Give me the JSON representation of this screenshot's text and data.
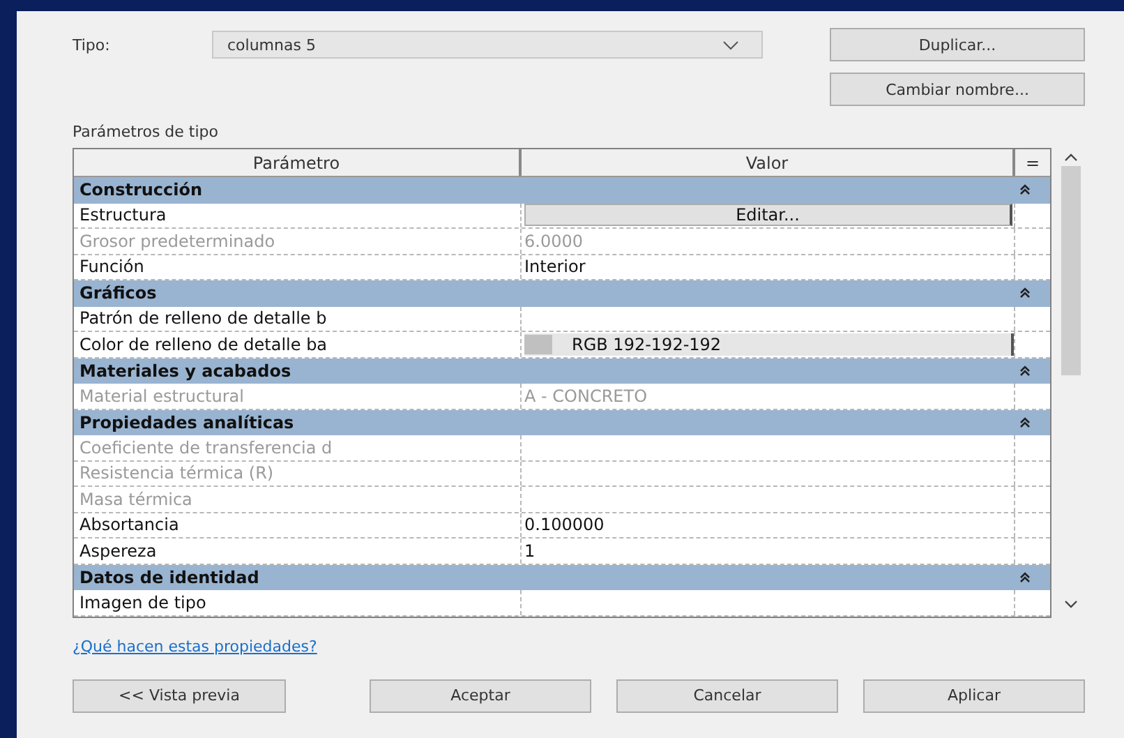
{
  "type_field": {
    "label": "Tipo:",
    "value": "columnas 5"
  },
  "top_buttons": [
    "Duplicar...",
    "Cambiar nombre..."
  ],
  "section_label": "Parámetros de tipo",
  "table": {
    "columns": [
      "Parámetro",
      "Valor",
      "="
    ],
    "rows": [
      {
        "kind": "group",
        "label": "Construcción",
        "expanded": true
      },
      {
        "kind": "param",
        "label": "Estructura",
        "disabled": false,
        "value": {
          "kind": "button",
          "text": "Editar..."
        }
      },
      {
        "kind": "param",
        "label": "Grosor predeterminado",
        "disabled": true,
        "value": {
          "kind": "text",
          "text": "6.0000"
        }
      },
      {
        "kind": "param",
        "label": "Función",
        "disabled": false,
        "value": {
          "kind": "text",
          "text": "Interior"
        }
      },
      {
        "kind": "group",
        "label": "Gráficos",
        "expanded": true
      },
      {
        "kind": "param",
        "label": "Patrón de relleno de detalle b",
        "disabled": false
      },
      {
        "kind": "param",
        "label": "Color de relleno de detalle ba",
        "disabled": false,
        "value": {
          "kind": "color",
          "text": "RGB 192-192-192",
          "color": "#c0c0c0"
        }
      },
      {
        "kind": "group",
        "label": "Materiales y acabados",
        "expanded": true
      },
      {
        "kind": "param",
        "label": "Material estructural",
        "disabled": true,
        "value": {
          "kind": "text",
          "text": "A - CONCRETO"
        }
      },
      {
        "kind": "group",
        "label": "Propiedades analíticas",
        "expanded": true
      },
      {
        "kind": "param",
        "label": "Coeficiente de transferencia d",
        "disabled": true
      },
      {
        "kind": "param",
        "label": "Resistencia térmica (R)",
        "disabled": true
      },
      {
        "kind": "param",
        "label": "Masa térmica",
        "disabled": true
      },
      {
        "kind": "param",
        "label": "Absortancia",
        "disabled": false,
        "value": {
          "kind": "text",
          "text": "0.100000"
        }
      },
      {
        "kind": "param",
        "label": "Aspereza",
        "disabled": false,
        "value": {
          "kind": "text",
          "text": "1"
        }
      },
      {
        "kind": "group",
        "label": "Datos de identidad",
        "expanded": true
      },
      {
        "kind": "param",
        "label": "Imagen de tipo",
        "disabled": false
      }
    ]
  },
  "help_link": "¿Qué hacen estas propiedades?",
  "bottom_buttons": [
    "<< Vista previa",
    "Aceptar",
    "Cancelar",
    "Aplicar"
  ]
}
